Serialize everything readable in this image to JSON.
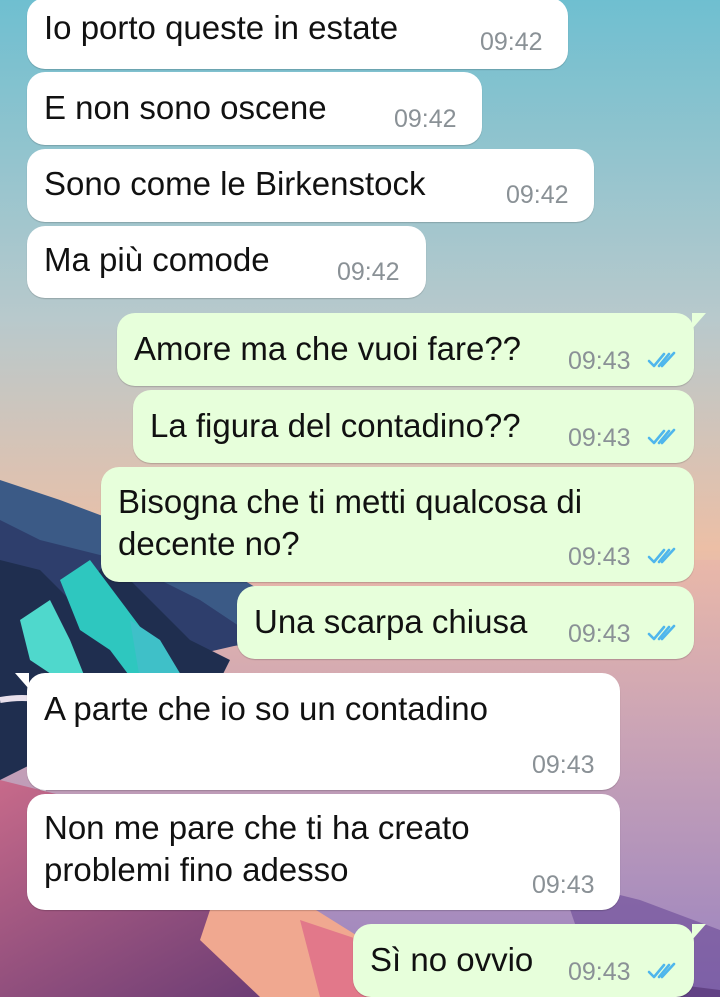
{
  "colors": {
    "incoming_bubble": "#ffffff",
    "outgoing_bubble": "#e7ffdb",
    "timestamp": "#8a9196",
    "read_ticks": "#4fb6ec"
  },
  "messages": [
    {
      "direction": "incoming",
      "text": "Io porto queste in estate",
      "time": "09:42"
    },
    {
      "direction": "incoming",
      "text": "E non sono oscene",
      "time": "09:42"
    },
    {
      "direction": "incoming",
      "text": "Sono come le Birkenstock",
      "time": "09:42"
    },
    {
      "direction": "incoming",
      "text": "Ma più comode",
      "time": "09:42"
    },
    {
      "direction": "outgoing",
      "text": "Amore ma che vuoi fare??",
      "time": "09:43",
      "status": "read-double-check-icon"
    },
    {
      "direction": "outgoing",
      "text": "La figura del contadino??",
      "time": "09:43",
      "status": "read-double-check-icon"
    },
    {
      "direction": "outgoing",
      "lines": [
        "Bisogna che ti metti qualcosa di",
        "decente no?"
      ],
      "time": "09:43",
      "status": "read-double-check-icon"
    },
    {
      "direction": "outgoing",
      "text": "Una scarpa chiusa",
      "time": "09:43",
      "status": "read-double-check-icon"
    },
    {
      "direction": "incoming",
      "text": "A parte che io so un contadino",
      "time": "09:43"
    },
    {
      "direction": "incoming",
      "lines": [
        "Non me pare che ti ha creato",
        "problemi fino adesso"
      ],
      "time": "09:43"
    },
    {
      "direction": "outgoing",
      "text": "Sì no ovvio",
      "time": "09:43",
      "status": "read-double-check-icon"
    }
  ]
}
